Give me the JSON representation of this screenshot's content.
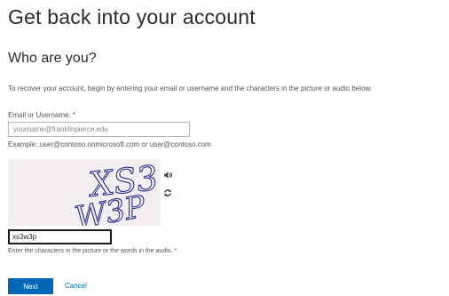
{
  "page": {
    "title": "Get back into your account",
    "subtitle": "Who are you?",
    "instructions": "To recover your account, begin by entering your email or username and the characters in the picture or audio below."
  },
  "email_field": {
    "label": "Email or Username: *",
    "placeholder": "yourname@franklinpierce.edu",
    "value": "",
    "example": "Example: user@contoso.onmicrosoft.com or user@contoso.com"
  },
  "captcha": {
    "text": "XS3W3P",
    "background": "#f3eef2",
    "ink_color": "#2a2f8a",
    "audio_icon": "speaker-icon",
    "refresh_icon": "refresh-icon",
    "input_value": "xs3w3p",
    "help": "Enter the characters in the picture or the words in the audio. *"
  },
  "actions": {
    "next_label": "Next",
    "cancel_label": "Cancel",
    "accent": "#0067b8"
  }
}
